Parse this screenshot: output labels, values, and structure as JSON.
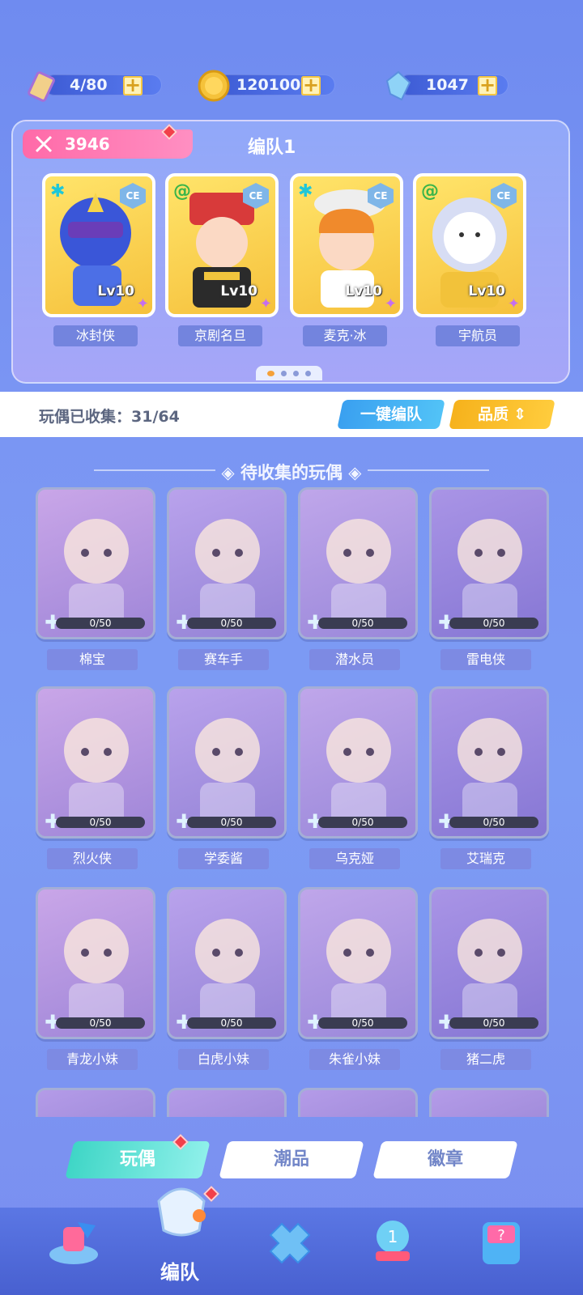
{
  "resources": [
    {
      "id": "stamina",
      "value": "4/80",
      "icon": "ticket-icon"
    },
    {
      "id": "coins",
      "value": "120100",
      "icon": "coin-icon"
    },
    {
      "id": "gems",
      "value": "1047",
      "icon": "crystal-icon"
    }
  ],
  "team": {
    "power": "3946",
    "title": "编队1",
    "members": [
      {
        "name": "冰封侠",
        "level": "Lv10",
        "badge": "CE"
      },
      {
        "name": "京剧名旦",
        "level": "Lv10",
        "badge": "CE"
      },
      {
        "name": "麦克·冰",
        "level": "Lv10",
        "badge": "CE"
      },
      {
        "name": "宇航员",
        "level": "Lv10",
        "badge": "CE"
      }
    ]
  },
  "collection": {
    "label": "玩偶已收集：31/64",
    "auto_button": "一键编队",
    "quality_button": "品质"
  },
  "section_title": "◈ 待收集的玩偶 ◈",
  "dolls": [
    {
      "name": "棉宝",
      "progress": "0/50"
    },
    {
      "name": "赛车手",
      "progress": "0/50"
    },
    {
      "name": "潜水员",
      "progress": "0/50"
    },
    {
      "name": "雷电侠",
      "progress": "0/50"
    },
    {
      "name": "烈火侠",
      "progress": "0/50"
    },
    {
      "name": "学委酱",
      "progress": "0/50"
    },
    {
      "name": "乌克娅",
      "progress": "0/50"
    },
    {
      "name": "艾瑞克",
      "progress": "0/50"
    },
    {
      "name": "青龙小妹",
      "progress": "0/50"
    },
    {
      "name": "白虎小妹",
      "progress": "0/50"
    },
    {
      "name": "朱雀小妹",
      "progress": "0/50"
    },
    {
      "name": "猪二虎",
      "progress": "0/50"
    }
  ],
  "tabs": [
    "玩偶",
    "潮品",
    "徽章"
  ],
  "nav": {
    "active_label": "编队"
  },
  "colors": {
    "accent_pink": "#ff6aa8",
    "accent_blue": "#3aa0f0",
    "accent_gold": "#f6b21c",
    "tab_active": "#3fd6c6"
  }
}
